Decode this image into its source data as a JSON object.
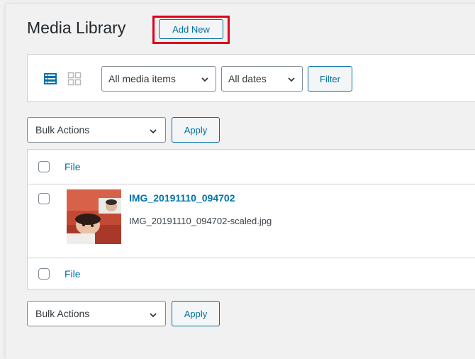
{
  "header": {
    "title": "Media Library",
    "add_new_label": "Add New"
  },
  "filters": {
    "list_view_icon": "list-view-icon",
    "grid_view_icon": "grid-view-icon",
    "media_type": "All media items",
    "dates": "All dates",
    "filter_label": "Filter"
  },
  "bulk_top": {
    "action": "Bulk Actions",
    "apply_label": "Apply"
  },
  "table": {
    "column_header": "File",
    "column_footer": "File",
    "rows": [
      {
        "title": "IMG_20191110_094702",
        "filename": "IMG_20191110_094702-scaled.jpg"
      }
    ]
  },
  "bulk_bottom": {
    "action": "Bulk Actions",
    "apply_label": "Apply"
  },
  "colors": {
    "accent": "#0071a1",
    "highlight": "#e0001b",
    "link": "#0073aa"
  }
}
